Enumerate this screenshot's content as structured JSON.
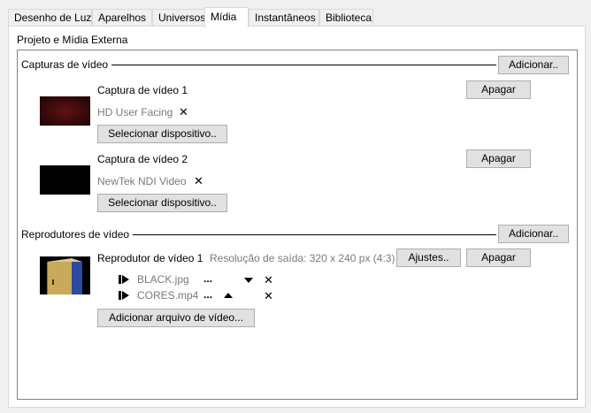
{
  "tabs": [
    {
      "label": "Desenho de Luz"
    },
    {
      "label": "Aparelhos"
    },
    {
      "label": "Universos"
    },
    {
      "label": "Mídia"
    },
    {
      "label": "Instantâneos"
    },
    {
      "label": "Biblioteca"
    }
  ],
  "active_tab": "Mídia",
  "panel": {
    "title": "Projeto e Mídia Externa"
  },
  "captures": {
    "section_label": "Capturas de vídeo",
    "add_label": "Adicionar..",
    "items": [
      {
        "title": "Captura de vídeo 1",
        "device": "HD User Facing",
        "delete_label": "Apagar",
        "select_label": "Selecionar dispositivo..",
        "remove_icon": "close-icon",
        "thumb_color": "#4a0e0e"
      },
      {
        "title": "Captura de vídeo 2",
        "device": "NewTek NDI Video",
        "delete_label": "Apagar",
        "select_label": "Selecionar dispositivo..",
        "remove_icon": "close-icon",
        "thumb_color": "#000000"
      }
    ]
  },
  "players": {
    "section_label": "Reprodutores de vídeo",
    "add_label": "Adicionar..",
    "items": [
      {
        "title": "Reprodutor de vídeo 1",
        "resolution": "Resolução de saída: 320 x 240 px (4:3)",
        "settings_label": "Ajustes..",
        "delete_label": "Apagar",
        "add_file_label": "Adicionar arquivo de vídeo...",
        "files": [
          {
            "name": "BLACK.jpg",
            "more": "...",
            "move_icon": "triangle-down-icon"
          },
          {
            "name": "CORES.mp4",
            "more": "...",
            "move_icon": "triangle-up-icon"
          }
        ]
      }
    ]
  },
  "colors": {
    "window_bg": "#f0f0f0",
    "panel_bg": "#ffffff",
    "button_bg": "#e1e1e1",
    "button_border": "#adadad",
    "muted_text": "#7a7a7a"
  }
}
